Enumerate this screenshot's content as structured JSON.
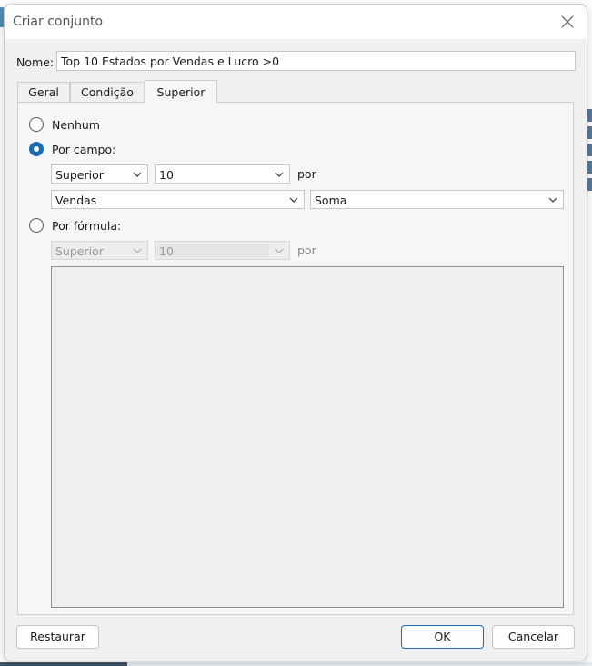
{
  "dialog": {
    "title": "Criar conjunto",
    "name_label": "Nome:",
    "name_value": "Top 10 Estados por Vendas e Lucro >0"
  },
  "tabs": [
    {
      "label": "Geral",
      "active": false
    },
    {
      "label": "Condição",
      "active": false
    },
    {
      "label": "Superior",
      "active": true
    }
  ],
  "options": {
    "none_label": "Nenhum",
    "by_field_label": "Por campo:",
    "by_formula_label": "Por fórmula:",
    "selected": "by_field"
  },
  "by_field": {
    "direction": "Superior",
    "count": "10",
    "por": "por",
    "field": "Vendas",
    "aggregation": "Soma"
  },
  "by_formula": {
    "direction": "Superior",
    "count": "10",
    "por": "por",
    "formula": ""
  },
  "buttons": {
    "reset": "Restaurar",
    "ok": "OK",
    "cancel": "Cancelar"
  },
  "colors": {
    "accent": "#1a6bb8",
    "dialog_bg": "#f0f0f0"
  }
}
